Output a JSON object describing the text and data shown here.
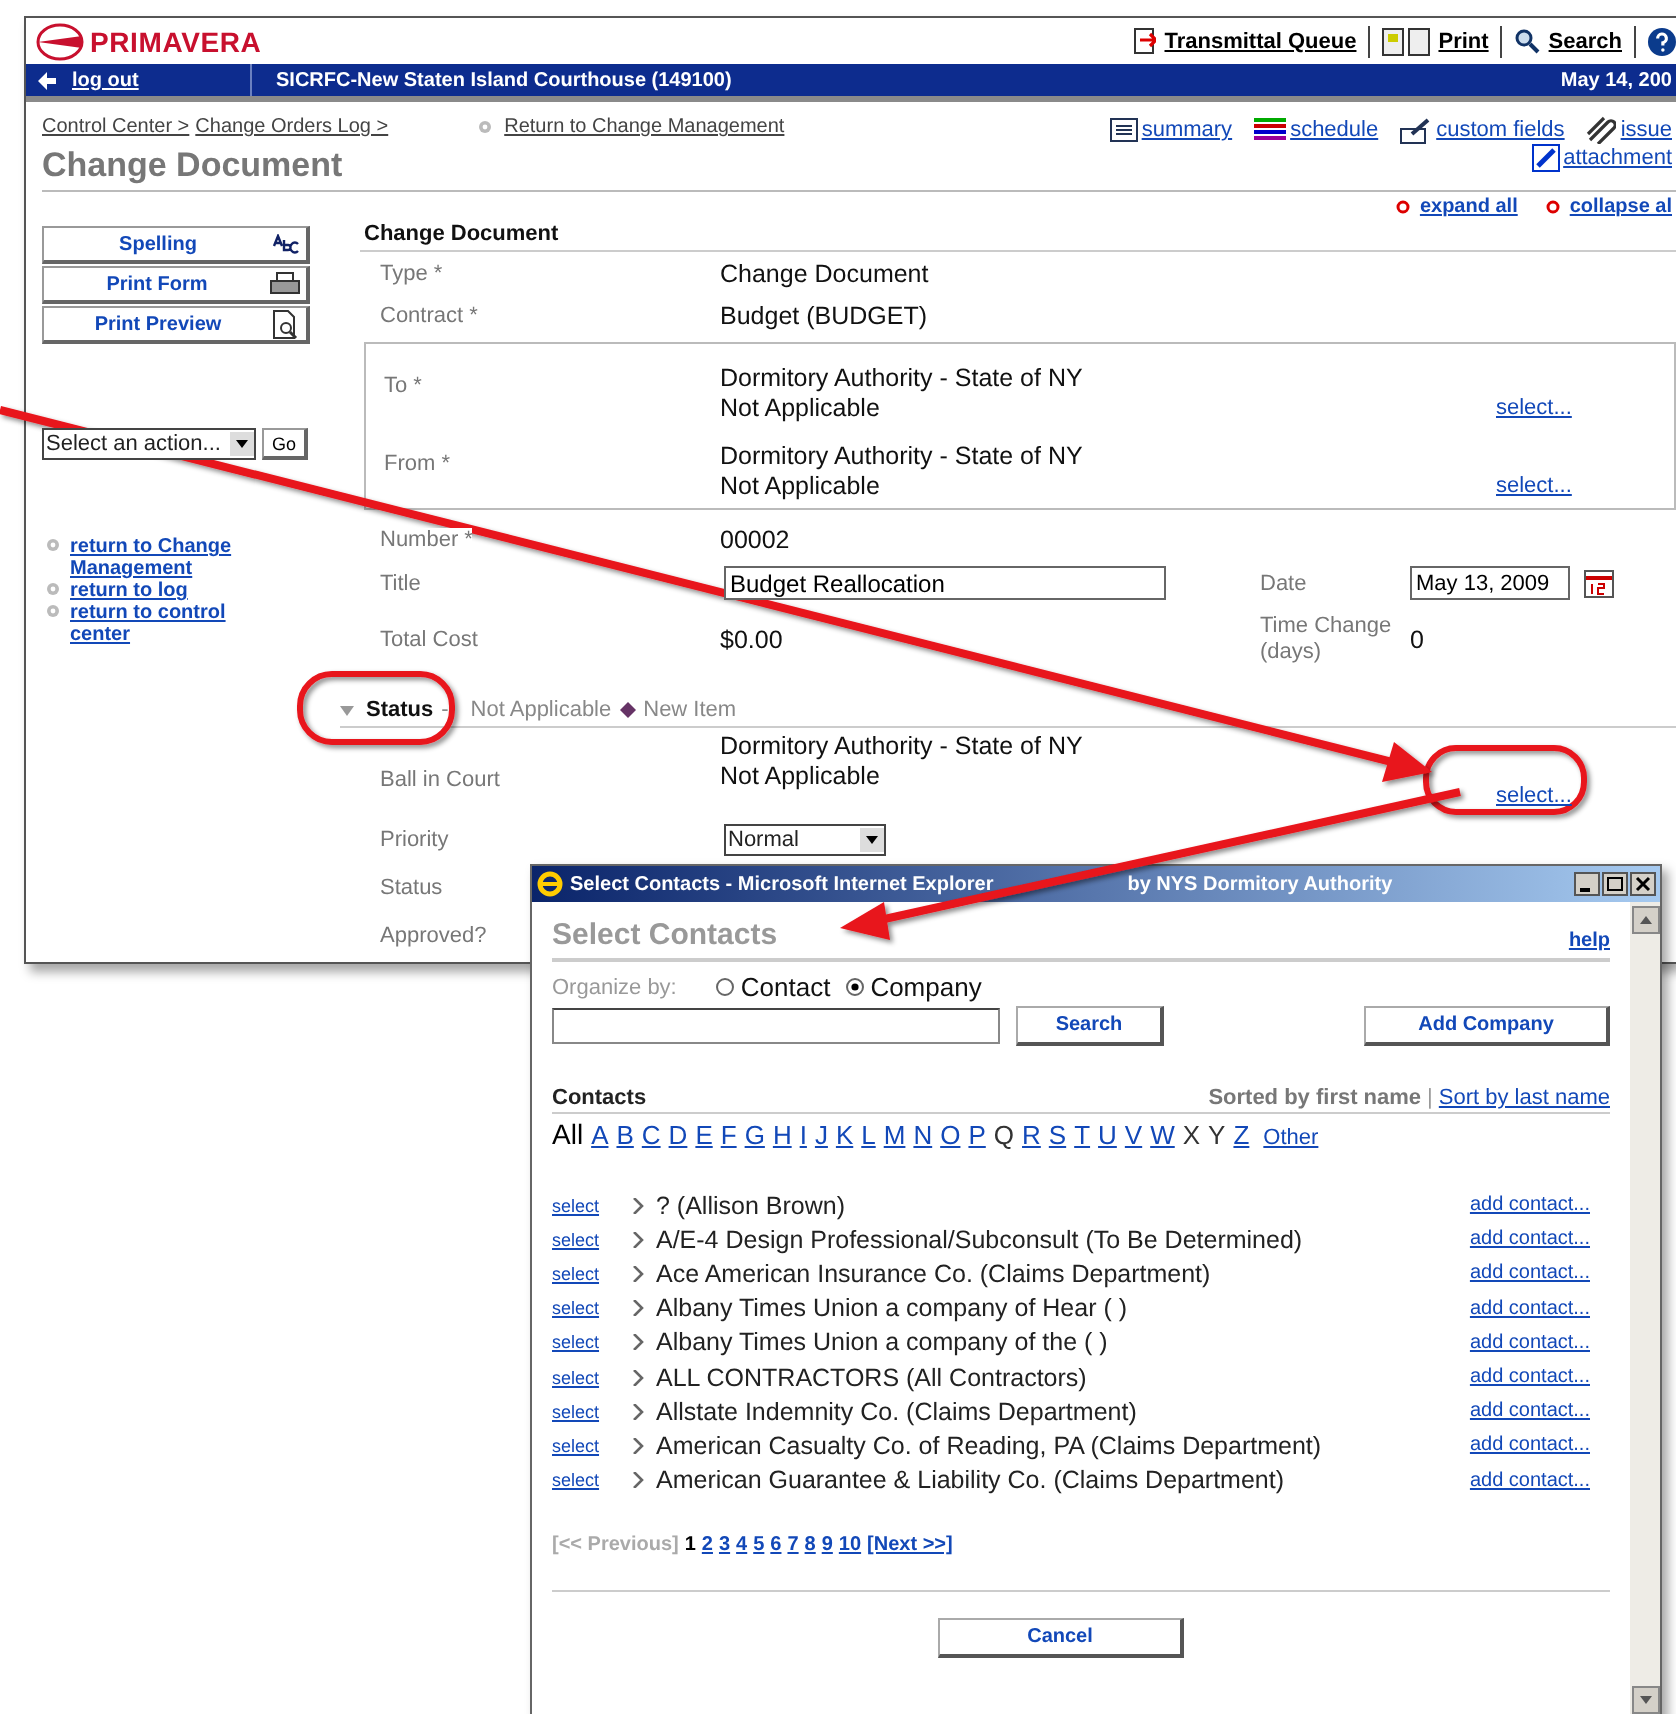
{
  "header": {
    "logo": "PRIMAVERA",
    "links": [
      "Transmittal Queue",
      "Print",
      "Search"
    ]
  },
  "project_bar": {
    "logout": "log out",
    "project": "SICRFC-New Staten Island Courthouse (149100)",
    "date": "May 14, 200"
  },
  "breadcrumb": [
    "Control Center >",
    "Change Orders Log >"
  ],
  "return_link": "Return to Change Management",
  "page_title": "Change Document",
  "tool_links": [
    "summary",
    "schedule",
    "custom fields",
    "issue",
    "attachment"
  ],
  "expand_links": [
    "expand all",
    "collapse al"
  ],
  "sidebar": {
    "buttons": [
      "Spelling",
      "Print Form",
      "Print Preview"
    ],
    "action_select": "Select an action...",
    "go": "Go",
    "links": [
      "return to Change Management",
      "return to log",
      "return to control center"
    ]
  },
  "form": {
    "title": "Change Document",
    "rows": [
      {
        "kind": "text",
        "label": "Type *",
        "value": "Change Document"
      },
      {
        "kind": "text",
        "label": "Contract *",
        "value": "Budget (BUDGET)"
      },
      {
        "kind": "group",
        "items": [
          {
            "label": "To *",
            "lines": [
              "Dormitory Authority - State of NY",
              "Not Applicable"
            ],
            "action": "select..."
          },
          {
            "label": "From *",
            "lines": [
              "Dormitory Authority - State of NY",
              "Not Applicable"
            ],
            "action": "select..."
          }
        ]
      },
      {
        "kind": "text",
        "label": "Number *",
        "value": "00002"
      },
      {
        "kind": "input",
        "label": "Title",
        "value": "Budget Reallocation",
        "side_label": "Date",
        "side_value": "May 13, 2009"
      },
      {
        "kind": "pair",
        "label": "Total Cost",
        "value": "$0.00",
        "side_label": "Time Change (days)",
        "side_value": "0"
      }
    ]
  },
  "status_section": {
    "expanded": true,
    "title": "Status",
    "separator": "-",
    "state": "Not Applicable",
    "item": "New Item",
    "rows": [
      {
        "kind": "contact",
        "label": "Ball in Court",
        "lines": [
          "Dormitory Authority - State of NY",
          "Not Applicable"
        ],
        "action": "select..."
      },
      {
        "kind": "select",
        "label": "Priority",
        "value": "Normal"
      },
      {
        "kind": "label",
        "label": "Status"
      },
      {
        "kind": "label",
        "label": "Approved?"
      }
    ]
  },
  "popup": {
    "title_parts": [
      "Select Contacts - Microsoft Internet Explorer",
      "by NYS Dormitory Authority"
    ],
    "heading": "Select Contacts",
    "help": "help",
    "organize_label": "Organize by:",
    "organize_options": [
      {
        "label": "Contact",
        "selected": false
      },
      {
        "label": "Company",
        "selected": true
      }
    ],
    "search_button": "Search",
    "add_button": "Add Company",
    "contacts_label": "Contacts",
    "sort_current": "Sorted by first name",
    "sort_separator": "|",
    "sort_link": "Sort by last name",
    "letters": [
      {
        "label": "All",
        "selected": true,
        "disabled": false
      },
      {
        "label": "A",
        "selected": false,
        "disabled": false
      },
      {
        "label": "B",
        "selected": false,
        "disabled": false
      },
      {
        "label": "C",
        "selected": false,
        "disabled": false
      },
      {
        "label": "D",
        "selected": false,
        "disabled": false
      },
      {
        "label": "E",
        "selected": false,
        "disabled": false
      },
      {
        "label": "F",
        "selected": false,
        "disabled": false
      },
      {
        "label": "G",
        "selected": false,
        "disabled": false
      },
      {
        "label": "H",
        "selected": false,
        "disabled": false
      },
      {
        "label": "I",
        "selected": false,
        "disabled": false
      },
      {
        "label": "J",
        "selected": false,
        "disabled": false
      },
      {
        "label": "K",
        "selected": false,
        "disabled": false
      },
      {
        "label": "L",
        "selected": false,
        "disabled": false
      },
      {
        "label": "M",
        "selected": false,
        "disabled": false
      },
      {
        "label": "N",
        "selected": false,
        "disabled": false
      },
      {
        "label": "O",
        "selected": false,
        "disabled": false
      },
      {
        "label": "P",
        "selected": false,
        "disabled": false
      },
      {
        "label": "Q",
        "selected": false,
        "disabled": true
      },
      {
        "label": "R",
        "selected": false,
        "disabled": false
      },
      {
        "label": "S",
        "selected": false,
        "disabled": false
      },
      {
        "label": "T",
        "selected": false,
        "disabled": false
      },
      {
        "label": "U",
        "selected": false,
        "disabled": false
      },
      {
        "label": "V",
        "selected": false,
        "disabled": false
      },
      {
        "label": "W",
        "selected": false,
        "disabled": false
      },
      {
        "label": "X",
        "selected": false,
        "disabled": true
      },
      {
        "label": "Y",
        "selected": false,
        "disabled": true
      },
      {
        "label": "Z",
        "selected": false,
        "disabled": false
      },
      {
        "label": "Other",
        "selected": false,
        "disabled": false
      }
    ],
    "rows": [
      {
        "select": "select",
        "name": "? (Allison Brown)",
        "action": "add contact..."
      },
      {
        "select": "select",
        "name": "A/E-4 Design Professional/Subconsult (To Be Determined)",
        "action": "add contact..."
      },
      {
        "select": "select",
        "name": "Ace American Insurance Co. (Claims Department)",
        "action": "add contact..."
      },
      {
        "select": "select",
        "name": "Albany Times Union a company of Hear ( )",
        "action": "add contact..."
      },
      {
        "select": "select",
        "name": "Albany Times Union a company of the ( )",
        "action": "add contact..."
      },
      {
        "select": "select",
        "name": "ALL CONTRACTORS (All Contractors)",
        "action": "add contact..."
      },
      {
        "select": "select",
        "name": "Allstate Indemnity Co. (Claims Department)",
        "action": "add contact..."
      },
      {
        "select": "select",
        "name": "American Casualty Co. of Reading, PA (Claims Department)",
        "action": "add contact..."
      },
      {
        "select": "select",
        "name": "American Guarantee & Liability Co. (Claims Department)",
        "action": "add contact..."
      }
    ],
    "pager": {
      "previous": "[<< Previous]",
      "pages": [
        {
          "label": "1",
          "selected": true
        },
        {
          "label": "2",
          "selected": false
        },
        {
          "label": "3",
          "selected": false
        },
        {
          "label": "4",
          "selected": false
        },
        {
          "label": "5",
          "selected": false
        },
        {
          "label": "6",
          "selected": false
        },
        {
          "label": "7",
          "selected": false
        },
        {
          "label": "8",
          "selected": false
        },
        {
          "label": "9",
          "selected": false
        },
        {
          "label": "10",
          "selected": false
        }
      ],
      "next": "[Next >>]"
    },
    "cancel": "Cancel"
  }
}
